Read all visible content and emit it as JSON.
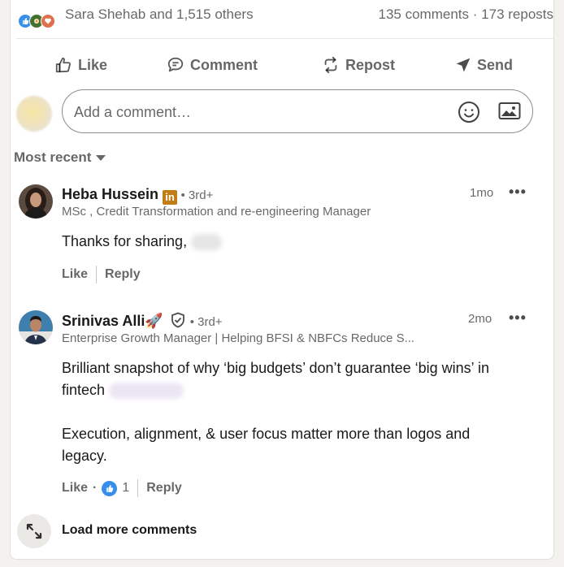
{
  "social": {
    "reactions": [
      "like-icon",
      "celebrate-icon",
      "love-icon"
    ],
    "reactor_names": "Sara Shehab and 1,515 others",
    "comments_count": "135 comments",
    "separator": "·",
    "reposts_count": "173 reposts"
  },
  "actions": {
    "like": "Like",
    "comment": "Comment",
    "repost": "Repost",
    "send": "Send"
  },
  "composer": {
    "placeholder": "Add a comment…"
  },
  "sort": {
    "label": "Most recent"
  },
  "comments": [
    {
      "name": "Heba Hussein",
      "badge": "in",
      "degree": "• 3rd+",
      "headline": "MSc , Credit Transformation and re-engineering Manager",
      "time": "1mo",
      "menu": "•••",
      "text": "Thanks for sharing,",
      "like": "Like",
      "reply": "Reply"
    },
    {
      "name": "Srinivas Alli🚀",
      "degree": "• 3rd+",
      "headline": "Enterprise Growth Manager | Helping BFSI & NBFCs Reduce S...",
      "time": "2mo",
      "menu": "•••",
      "text_line1": "Brilliant snapshot of why ‘big budgets’ don’t guarantee ‘big wins’ in",
      "text_line2": "fintech",
      "text_line3": "Execution, alignment, & user focus matter more than logos and",
      "text_line4": "legacy.",
      "like": "Like",
      "dot": "·",
      "reaction_count": "1",
      "reply": "Reply"
    }
  ],
  "load_more": {
    "label": "Load more comments"
  },
  "colors": {
    "like_blue": "#378fe9",
    "celebrate_green": "#44712e",
    "love_orange": "#df704d",
    "premium_gold": "#c37d16"
  }
}
